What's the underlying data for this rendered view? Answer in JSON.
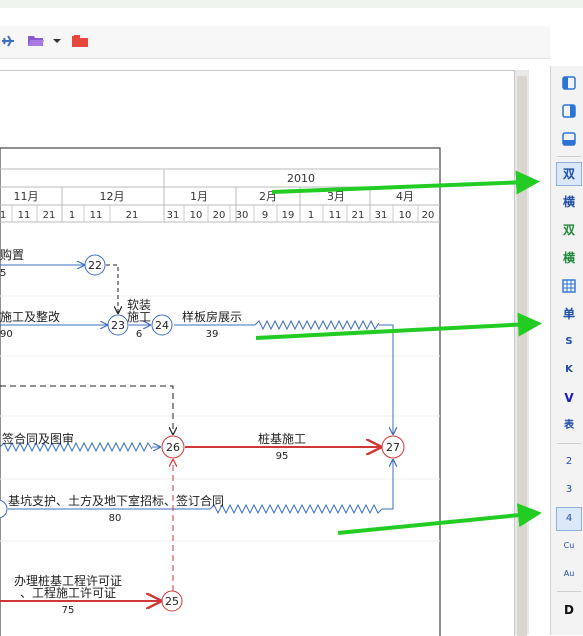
{
  "timeline": {
    "year": "2010",
    "months": [
      "11月",
      "12月",
      "1月",
      "2月",
      "3月",
      "4月"
    ],
    "days": [
      "1",
      "11",
      "21",
      "1",
      "11",
      "21",
      "31",
      "10",
      "20",
      "30",
      "9",
      "19",
      "1",
      "11",
      "21",
      "31",
      "10",
      "20"
    ]
  },
  "nodes": [
    {
      "id": "22",
      "color": "#3d6fc2"
    },
    {
      "id": "23",
      "color": "#3d6fc2"
    },
    {
      "id": "24",
      "color": "#3d6fc2"
    },
    {
      "id": "26",
      "color": "#d03838"
    },
    {
      "id": "27",
      "color": "#d03838"
    },
    {
      "id": "25",
      "color": "#d03838"
    }
  ],
  "tasks": [
    {
      "name": "购置",
      "duration": "5"
    },
    {
      "name": "施工及整改",
      "duration": "90"
    },
    {
      "name": "软装",
      "name2": "施工",
      "duration": "6"
    },
    {
      "name": "样板房展示",
      "duration": "39"
    },
    {
      "name": "签合同及图审",
      "duration": ""
    },
    {
      "name": "桩基施工",
      "duration": "95"
    },
    {
      "name": "基坑支护、土方及地下室招标、签订合同",
      "duration": "80"
    },
    {
      "name": "办理桩基工程许可证",
      "name2": "、工程施工许可证",
      "duration": "75"
    }
  ],
  "side_panel": {
    "buttons": [
      "双",
      "横",
      "双",
      "横",
      "单",
      "S",
      "K",
      "V",
      "表",
      "2",
      "3",
      "4",
      "Cu",
      "Au",
      "D"
    ],
    "active": [
      "双",
      "4"
    ]
  },
  "colors": {
    "critical": "#d03838",
    "normal": "#3d6fc2",
    "callout_arrow": "#22cc22"
  }
}
